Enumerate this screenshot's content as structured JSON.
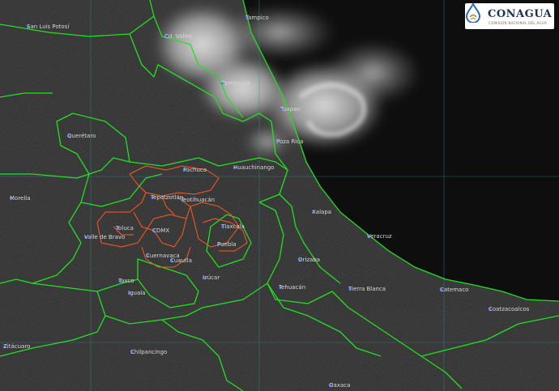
{
  "logo": {
    "name": "CONAGUA",
    "subtitle": "COMISIÓN NACIONAL DEL AGUA",
    "colors": {
      "text": "#1c2f55",
      "drop_blue": "#2f6db5",
      "drop_gold": "#b8923a"
    }
  },
  "cities": [
    "San Luis Potosí",
    "Cd. Valles",
    "Tampico",
    "Tantoyuca",
    "Tuxpan",
    "Querétaro",
    "Poza Rica",
    "Pachuca",
    "Huauchinango",
    "Tepotzotlán",
    "Teotihuacán",
    "Morelia",
    "Xalapa",
    "Tlaxcala",
    "Toluca",
    "CDMX",
    "Valle de Bravo",
    "Puebla",
    "Veracruz",
    "Cuernavaca",
    "Cuautla",
    "Orizaba",
    "Izúcar",
    "Taxco",
    "Tehuacán",
    "Tierra Blanca",
    "Catemaco",
    "Iguala",
    "Coatzacoalcos",
    "Zitácuaro",
    "Chilpancingo",
    "Oaxaca"
  ],
  "colors": {
    "state_borders": "#22e022",
    "cdmx_borders": "#ff5a1e",
    "city_marker": "#3060ff",
    "label": "#d8d8d8",
    "grid": "#2a8aa0",
    "sea": "#0e0e0e",
    "land": "#2a2a2a",
    "clouds": "#d0d0d0"
  }
}
